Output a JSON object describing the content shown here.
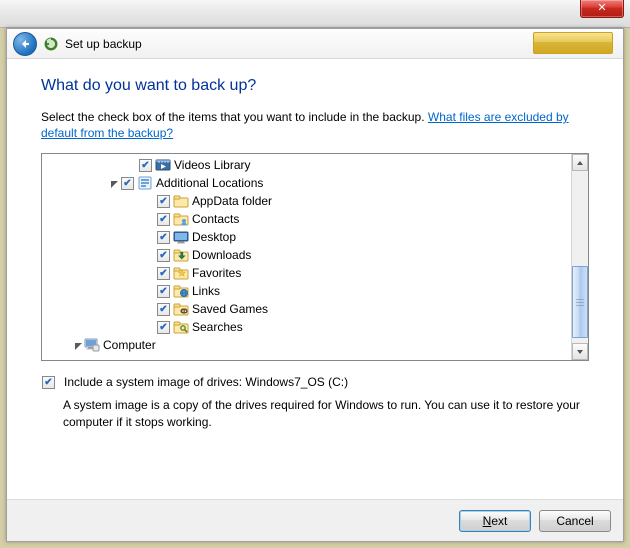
{
  "titlebar": {},
  "header": {
    "title": "Set up backup"
  },
  "heading": "What do you want to back up?",
  "instruction_prefix": "Select the check box of the items that you want to include in the backup. ",
  "instruction_link": "What files are excluded by default from the backup?",
  "tree": {
    "items": [
      {
        "indent": 84,
        "expander": "none",
        "checked": true,
        "icon": "video-library",
        "label": "Videos Library"
      },
      {
        "indent": 66,
        "expander": "open",
        "checked": true,
        "icon": "location",
        "label": "Additional Locations"
      },
      {
        "indent": 102,
        "expander": "none",
        "checked": true,
        "icon": "folder",
        "label": "AppData folder"
      },
      {
        "indent": 102,
        "expander": "none",
        "checked": true,
        "icon": "contacts",
        "label": "Contacts"
      },
      {
        "indent": 102,
        "expander": "none",
        "checked": true,
        "icon": "desktop",
        "label": "Desktop"
      },
      {
        "indent": 102,
        "expander": "none",
        "checked": true,
        "icon": "downloads",
        "label": "Downloads"
      },
      {
        "indent": 102,
        "expander": "none",
        "checked": true,
        "icon": "favorites",
        "label": "Favorites"
      },
      {
        "indent": 102,
        "expander": "none",
        "checked": true,
        "icon": "links",
        "label": "Links"
      },
      {
        "indent": 102,
        "expander": "none",
        "checked": true,
        "icon": "savedgames",
        "label": "Saved Games"
      },
      {
        "indent": 102,
        "expander": "none",
        "checked": true,
        "icon": "searches",
        "label": "Searches"
      },
      {
        "indent": 30,
        "expander": "open",
        "checked": null,
        "icon": "computer",
        "label": "Computer"
      }
    ]
  },
  "system_image": {
    "checked": true,
    "label": "Include a system image of drives: Windows7_OS (C:)",
    "description": "A system image is a copy of the drives required for Windows to run. You can use it to restore your computer if it stops working."
  },
  "footer": {
    "next": "Next",
    "next_accel": "N",
    "cancel": "Cancel"
  }
}
